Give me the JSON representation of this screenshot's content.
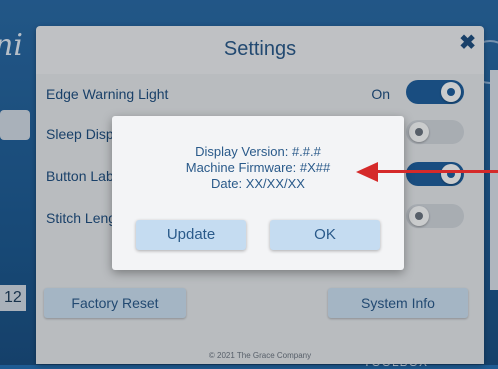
{
  "settings": {
    "title": "Settings",
    "close_icon": "✖",
    "rows": [
      {
        "label": "Edge Warning Light",
        "state_text": "On",
        "toggle": "on"
      },
      {
        "label": "Sleep Disp",
        "toggle": "off"
      },
      {
        "label": "Button Lab",
        "toggle": "on"
      },
      {
        "label": "Stitch Leng",
        "toggle": "off"
      }
    ],
    "factory_reset_label": "Factory Reset",
    "system_info_label": "System Info",
    "copyright": "© 2021 The Grace Company"
  },
  "dialog": {
    "display_version": "Display Version: #.#.#",
    "machine_firmware": "Machine Firmware: #X##",
    "date": "Date: XX/XX/XX",
    "update_label": "Update",
    "ok_label": "OK"
  },
  "background": {
    "brand_fragment": "ni",
    "left_number": "12",
    "bottom_word": "TOOLBOX"
  },
  "colors": {
    "accent": "#1f5f9d",
    "annotation_arrow": "#d52a2a"
  }
}
